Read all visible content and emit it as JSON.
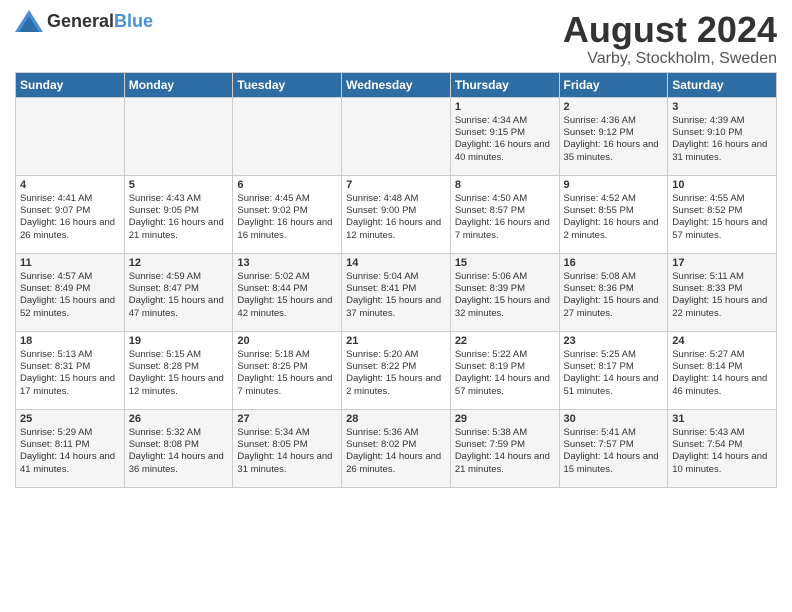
{
  "logo": {
    "text_general": "General",
    "text_blue": "Blue"
  },
  "title": {
    "month_year": "August 2024",
    "location": "Varby, Stockholm, Sweden"
  },
  "weekdays": [
    "Sunday",
    "Monday",
    "Tuesday",
    "Wednesday",
    "Thursday",
    "Friday",
    "Saturday"
  ],
  "weeks": [
    [
      {
        "day": "",
        "info": ""
      },
      {
        "day": "",
        "info": ""
      },
      {
        "day": "",
        "info": ""
      },
      {
        "day": "",
        "info": ""
      },
      {
        "day": "1",
        "info": "Sunrise: 4:34 AM\nSunset: 9:15 PM\nDaylight: 16 hours and 40 minutes."
      },
      {
        "day": "2",
        "info": "Sunrise: 4:36 AM\nSunset: 9:12 PM\nDaylight: 16 hours and 35 minutes."
      },
      {
        "day": "3",
        "info": "Sunrise: 4:39 AM\nSunset: 9:10 PM\nDaylight: 16 hours and 31 minutes."
      }
    ],
    [
      {
        "day": "4",
        "info": "Sunrise: 4:41 AM\nSunset: 9:07 PM\nDaylight: 16 hours and 26 minutes."
      },
      {
        "day": "5",
        "info": "Sunrise: 4:43 AM\nSunset: 9:05 PM\nDaylight: 16 hours and 21 minutes."
      },
      {
        "day": "6",
        "info": "Sunrise: 4:45 AM\nSunset: 9:02 PM\nDaylight: 16 hours and 16 minutes."
      },
      {
        "day": "7",
        "info": "Sunrise: 4:48 AM\nSunset: 9:00 PM\nDaylight: 16 hours and 12 minutes."
      },
      {
        "day": "8",
        "info": "Sunrise: 4:50 AM\nSunset: 8:57 PM\nDaylight: 16 hours and 7 minutes."
      },
      {
        "day": "9",
        "info": "Sunrise: 4:52 AM\nSunset: 8:55 PM\nDaylight: 16 hours and 2 minutes."
      },
      {
        "day": "10",
        "info": "Sunrise: 4:55 AM\nSunset: 8:52 PM\nDaylight: 15 hours and 57 minutes."
      }
    ],
    [
      {
        "day": "11",
        "info": "Sunrise: 4:57 AM\nSunset: 8:49 PM\nDaylight: 15 hours and 52 minutes."
      },
      {
        "day": "12",
        "info": "Sunrise: 4:59 AM\nSunset: 8:47 PM\nDaylight: 15 hours and 47 minutes."
      },
      {
        "day": "13",
        "info": "Sunrise: 5:02 AM\nSunset: 8:44 PM\nDaylight: 15 hours and 42 minutes."
      },
      {
        "day": "14",
        "info": "Sunrise: 5:04 AM\nSunset: 8:41 PM\nDaylight: 15 hours and 37 minutes."
      },
      {
        "day": "15",
        "info": "Sunrise: 5:06 AM\nSunset: 8:39 PM\nDaylight: 15 hours and 32 minutes."
      },
      {
        "day": "16",
        "info": "Sunrise: 5:08 AM\nSunset: 8:36 PM\nDaylight: 15 hours and 27 minutes."
      },
      {
        "day": "17",
        "info": "Sunrise: 5:11 AM\nSunset: 8:33 PM\nDaylight: 15 hours and 22 minutes."
      }
    ],
    [
      {
        "day": "18",
        "info": "Sunrise: 5:13 AM\nSunset: 8:31 PM\nDaylight: 15 hours and 17 minutes."
      },
      {
        "day": "19",
        "info": "Sunrise: 5:15 AM\nSunset: 8:28 PM\nDaylight: 15 hours and 12 minutes."
      },
      {
        "day": "20",
        "info": "Sunrise: 5:18 AM\nSunset: 8:25 PM\nDaylight: 15 hours and 7 minutes."
      },
      {
        "day": "21",
        "info": "Sunrise: 5:20 AM\nSunset: 8:22 PM\nDaylight: 15 hours and 2 minutes."
      },
      {
        "day": "22",
        "info": "Sunrise: 5:22 AM\nSunset: 8:19 PM\nDaylight: 14 hours and 57 minutes."
      },
      {
        "day": "23",
        "info": "Sunrise: 5:25 AM\nSunset: 8:17 PM\nDaylight: 14 hours and 51 minutes."
      },
      {
        "day": "24",
        "info": "Sunrise: 5:27 AM\nSunset: 8:14 PM\nDaylight: 14 hours and 46 minutes."
      }
    ],
    [
      {
        "day": "25",
        "info": "Sunrise: 5:29 AM\nSunset: 8:11 PM\nDaylight: 14 hours and 41 minutes."
      },
      {
        "day": "26",
        "info": "Sunrise: 5:32 AM\nSunset: 8:08 PM\nDaylight: 14 hours and 36 minutes."
      },
      {
        "day": "27",
        "info": "Sunrise: 5:34 AM\nSunset: 8:05 PM\nDaylight: 14 hours and 31 minutes."
      },
      {
        "day": "28",
        "info": "Sunrise: 5:36 AM\nSunset: 8:02 PM\nDaylight: 14 hours and 26 minutes."
      },
      {
        "day": "29",
        "info": "Sunrise: 5:38 AM\nSunset: 7:59 PM\nDaylight: 14 hours and 21 minutes."
      },
      {
        "day": "30",
        "info": "Sunrise: 5:41 AM\nSunset: 7:57 PM\nDaylight: 14 hours and 15 minutes."
      },
      {
        "day": "31",
        "info": "Sunrise: 5:43 AM\nSunset: 7:54 PM\nDaylight: 14 hours and 10 minutes."
      }
    ]
  ]
}
